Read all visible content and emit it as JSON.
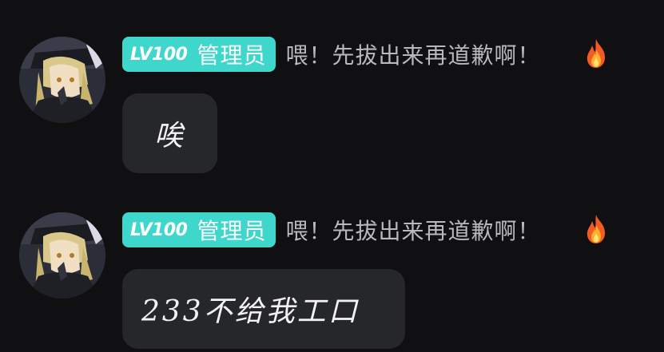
{
  "messages": [
    {
      "badge": {
        "level": "LV100",
        "role": "管理员"
      },
      "sender_name": "喂！先拔出来再道歉啊！",
      "decoration_icon": "fire-icon",
      "text": "唉"
    },
    {
      "badge": {
        "level": "LV100",
        "role": "管理员"
      },
      "sender_name": "喂！先拔出来再道歉啊！",
      "decoration_icon": "fire-icon",
      "text": "233不给我工口"
    }
  ],
  "colors": {
    "background": "#101012",
    "badge": "#3fd6cc",
    "bubble": "#26272b",
    "sender_text": "#b9b9bd",
    "message_text": "#f2f2f2"
  }
}
